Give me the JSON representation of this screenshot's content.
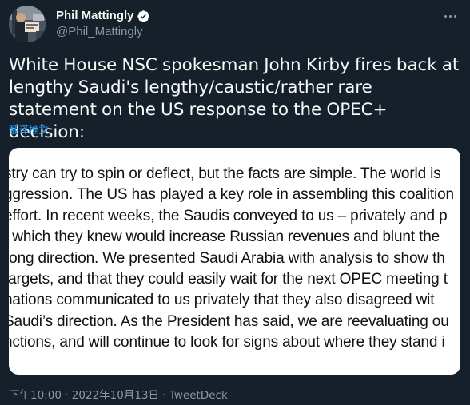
{
  "author": {
    "name": "Phil Mattingly",
    "handle": "@Phil_Mattingly",
    "verified": true
  },
  "tweet": {
    "text": "White House NSC spokesman John Kirby fires back at lengthy Saudi's lengthy/caustic/rather rare statement on the US response to the OPEC+ decision:",
    "translate_label": "翻译推文"
  },
  "media": {
    "lines": [
      "stry can try to spin or deflect, but the facts are simple.  The world is",
      "ggression.  The US has played a key role in assembling this coalition",
      "effort.  In recent weeks, the Saudis conveyed to us – privately and p",
      ", which they knew would increase Russian revenues and blunt the",
      "rong direction.  We presented Saudi Arabia with analysis to show th",
      "targets, and that they could easily wait for the next OPEC meeting t",
      "nations communicated to us privately that they also disagreed wit",
      "Saudi’s direction.  As the President has said, we are reevaluating ou",
      "nctions, and will continue to look for signs about where they stand i",
      "/"
    ]
  },
  "meta": {
    "time": "下午10:00",
    "separator": " · ",
    "date": "2022年10月13日",
    "source": "TweetDeck"
  },
  "colors": {
    "background": "#15202b",
    "text": "#f7f9f9",
    "secondary": "#8b98a5",
    "link": "#1d9bf0",
    "verified": "#ffffff"
  },
  "icons": {
    "verified": "verified-badge-icon",
    "more": "more-dots-icon"
  }
}
